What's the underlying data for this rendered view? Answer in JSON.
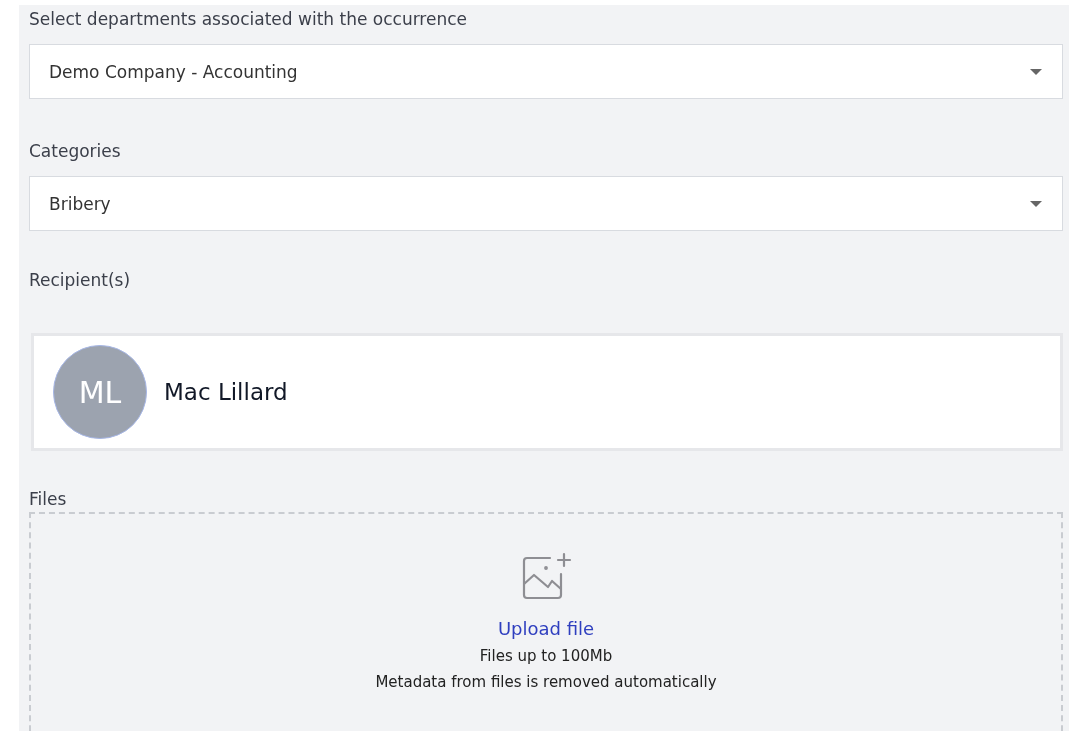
{
  "fields": [
    {
      "label": "Select departments associated with the occurrence",
      "value": "Demo Company - Accounting"
    },
    {
      "label": "Categories",
      "value": "Bribery"
    }
  ],
  "recipients": {
    "label": "Recipient(s)",
    "people": [
      {
        "initials": "ML",
        "name": "Mac Lillard"
      }
    ]
  },
  "files": {
    "label": "Files",
    "upload_link": "Upload file",
    "limit": "Files up to 100Mb",
    "note": "Metadata from files is removed automatically"
  }
}
